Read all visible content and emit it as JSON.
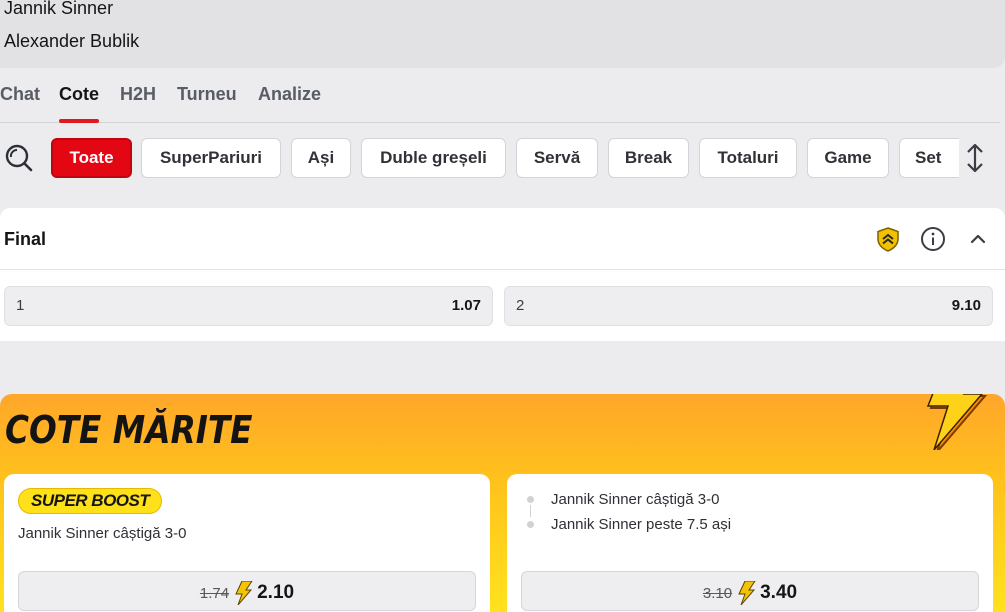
{
  "match": {
    "player1": "Jannik Sinner",
    "player2": "Alexander Bublik"
  },
  "tabs": [
    {
      "label": "Chat",
      "active": false
    },
    {
      "label": "Cote",
      "active": true
    },
    {
      "label": "H2H",
      "active": false
    },
    {
      "label": "Turneu",
      "active": false
    },
    {
      "label": "Analize",
      "active": false
    }
  ],
  "filters": {
    "icons": {
      "search": "search-icon",
      "sort": "sort-arrows-icon"
    },
    "chips": [
      {
        "label": "Toate",
        "active": true
      },
      {
        "label": "SuperPariuri",
        "active": false
      },
      {
        "label": "Ași",
        "active": false
      },
      {
        "label": "Duble greșeli",
        "active": false
      },
      {
        "label": "Servă",
        "active": false
      },
      {
        "label": "Break",
        "active": false
      },
      {
        "label": "Totaluri",
        "active": false
      },
      {
        "label": "Game",
        "active": false
      },
      {
        "label": "Set",
        "active": false
      }
    ]
  },
  "market": {
    "title": "Final",
    "icons": [
      "shield-chevrons-icon",
      "info-icon",
      "chevron-up-icon"
    ],
    "outcomes": [
      {
        "label": "1",
        "odd": "1.07"
      },
      {
        "label": "2",
        "odd": "9.10"
      }
    ]
  },
  "boost": {
    "title": "COTE MĂRITE",
    "cards": [
      {
        "badge": "SUPER BOOST",
        "selections": [
          "Jannik Sinner câștigă 3-0"
        ],
        "old_odd": "1.74",
        "new_odd": "2.10"
      },
      {
        "badge": "",
        "selections": [
          "Jannik Sinner câștigă 3-0",
          "Jannik Sinner peste 7.5 ași"
        ],
        "old_odd": "3.10",
        "new_odd": "3.40"
      }
    ]
  },
  "colors": {
    "brand_red": "#e30613",
    "boost_yellow": "#ffe11a",
    "boost_orange": "#ffa62a"
  }
}
